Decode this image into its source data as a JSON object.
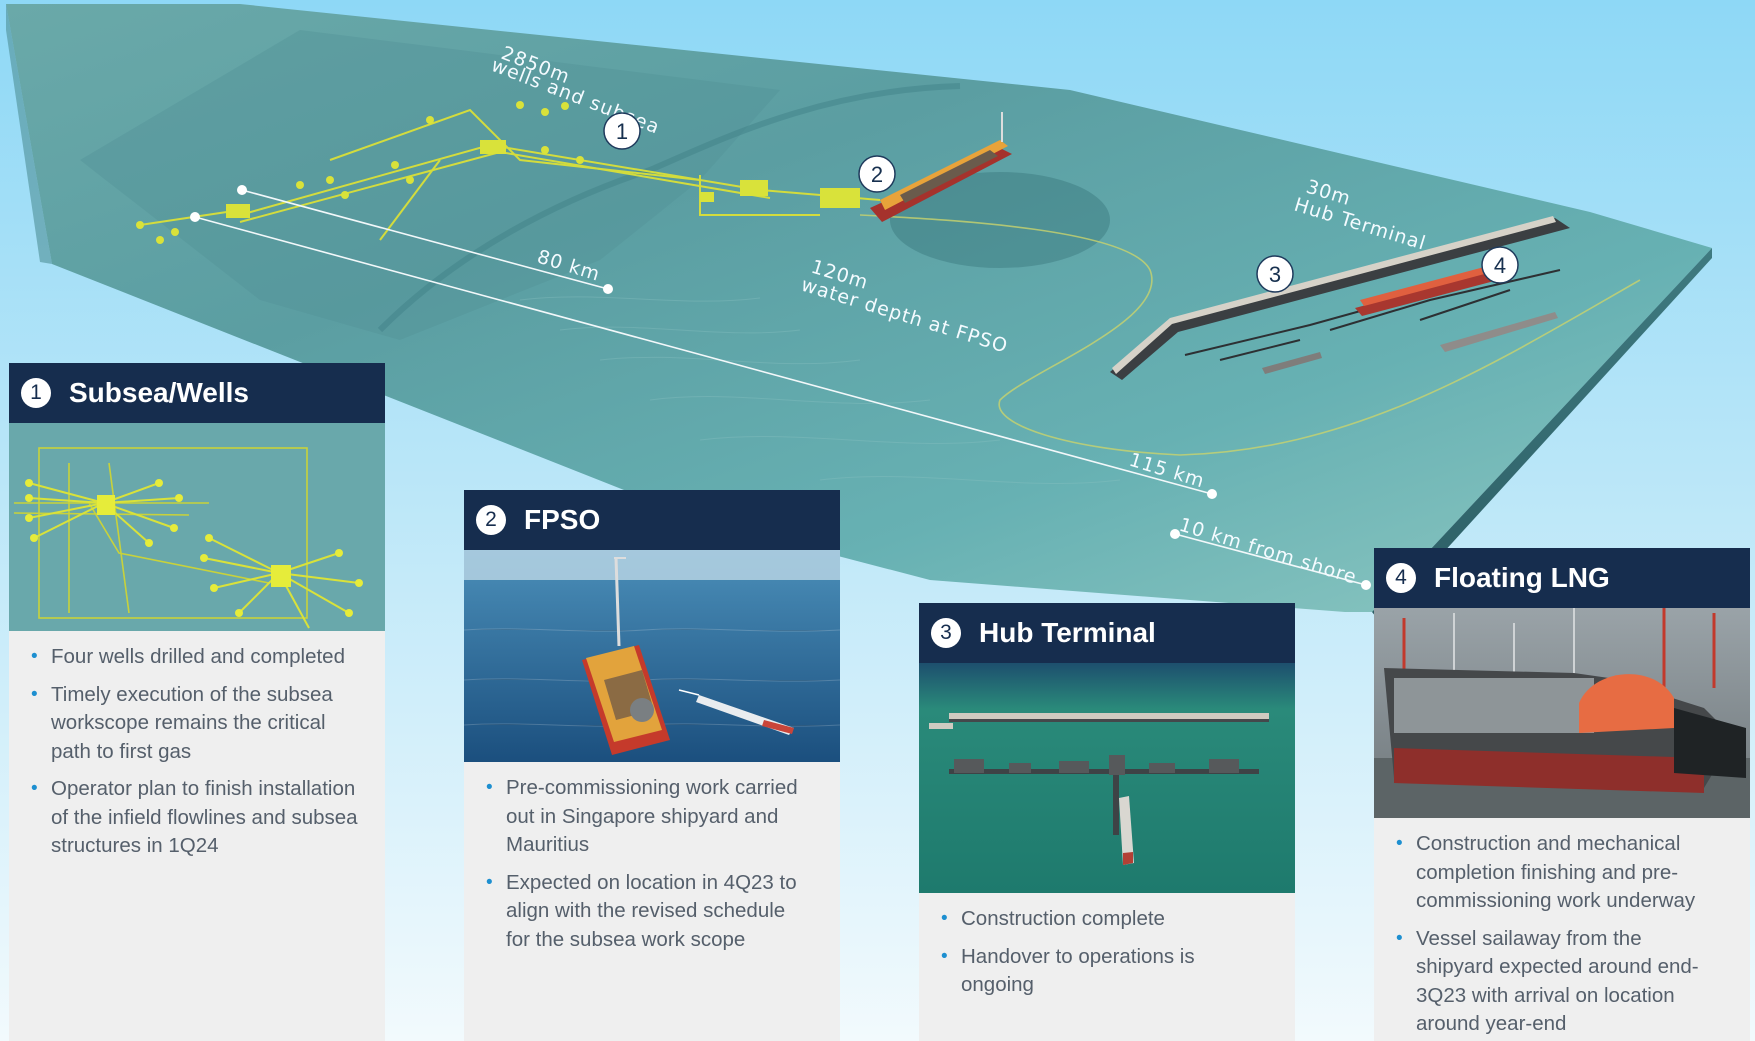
{
  "map": {
    "labels": {
      "wells_depth": "2850m",
      "wells_caption": "wells and subsea",
      "dist_80": "80 km",
      "fpso_depth": "120m",
      "fpso_caption": "water depth at FPSO",
      "hub_depth": "30m",
      "hub_caption": "Hub Terminal",
      "dist_115": "115 km",
      "shore_dist": "10 km from shore"
    },
    "callouts": [
      "1",
      "2",
      "3",
      "4"
    ]
  },
  "panels": [
    {
      "number": "1",
      "title": "Subsea/Wells",
      "image": "subsea-layout-image",
      "bullets": [
        "Four wells drilled and completed",
        "Timely execution of the subsea workscope remains the critical path to first gas",
        "Operator plan to finish installation of the infield flowlines and subsea structures in 1Q24"
      ]
    },
    {
      "number": "2",
      "title": "FPSO",
      "image": "fpso-vessel-image",
      "bullets": [
        "Pre-commissioning work carried out in Singapore shipyard and Mauritius",
        "Expected on location in 4Q23 to align with the revised schedule for the subsea work scope"
      ]
    },
    {
      "number": "3",
      "title": "Hub Terminal",
      "image": "hub-terminal-image",
      "bullets": [
        "Construction complete",
        "Handover to operations is ongoing"
      ]
    },
    {
      "number": "4",
      "title": "Floating LNG",
      "image": "flng-vessel-image",
      "bullets": [
        "Construction and mechanical completion finishing and pre-commissioning work underway",
        "Vessel sailaway from the shipyard expected around end-3Q23 with arrival on location around year-end"
      ]
    }
  ],
  "colors": {
    "panel_header": "#162d4e",
    "bullet_marker": "#1d8fd0",
    "bullet_text": "#555f6b",
    "sea": "#5fa7ab",
    "subsea_equipment": "#d9e23a"
  }
}
